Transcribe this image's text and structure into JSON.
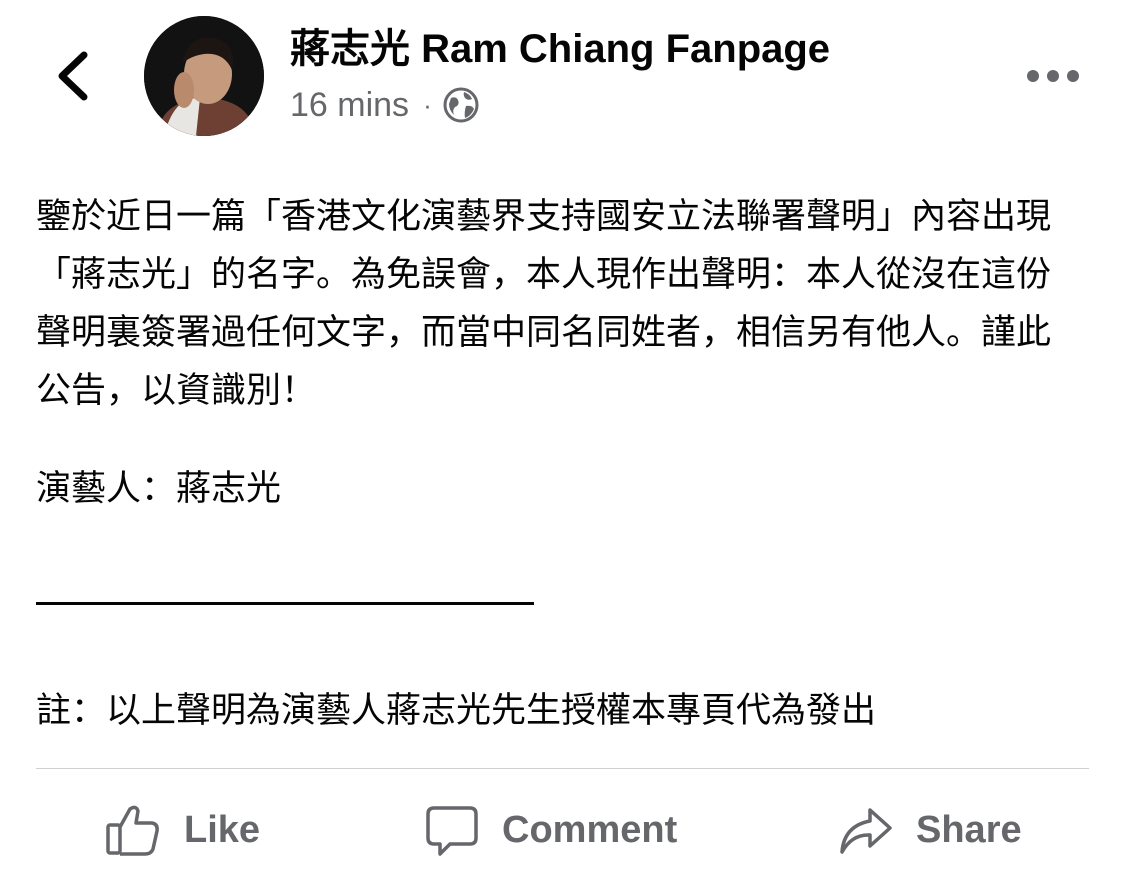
{
  "post": {
    "author": "蔣志光 Ram Chiang Fanpage",
    "time": "16 mins",
    "separator": "·",
    "privacy_icon": "globe-icon",
    "body": "鑒於近日一篇「香港文化演藝界支持國安立法聯署聲明」內容出現「蔣志光」的名字。為免誤會，本人現作出聲明：本人從沒在這份聲明裏簽署過任何文字，而當中同名同姓者，相信另有他人。謹此公告，以資識別！",
    "signature": "演藝人：蔣志光",
    "note": "註：以上聲明為演藝人蔣志光先生授權本專頁代為發出"
  },
  "actions": {
    "like": "Like",
    "comment": "Comment",
    "share": "Share"
  },
  "icons": {
    "back": "chevron-left-icon",
    "more": "more-dots-icon",
    "like": "thumbs-up-icon",
    "comment": "speech-bubble-icon",
    "share": "share-arrow-icon"
  },
  "colors": {
    "text": "#050505",
    "secondary": "#65676b",
    "divider": "#ced0d4"
  }
}
